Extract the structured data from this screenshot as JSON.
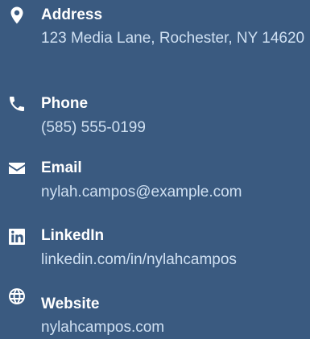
{
  "contact": {
    "items": [
      {
        "icon": "map-marker-icon",
        "label": "Address",
        "value": "123 Media Lane, Rochester, NY 14620"
      },
      {
        "icon": "phone-icon",
        "label": "Phone",
        "value": "(585) 555-0199"
      },
      {
        "icon": "envelope-icon",
        "label": "Email",
        "value": "nylah.campos@example.com"
      },
      {
        "icon": "linkedin-icon",
        "label": "LinkedIn",
        "value": "linkedin.com/in/nylahcampos"
      },
      {
        "icon": "globe-icon",
        "label": "Website",
        "value": "nylahcampos.com"
      }
    ]
  },
  "colors": {
    "background": "#3a5a80",
    "label": "#ffffff",
    "value": "#cfe0f2",
    "icon": "#ffffff"
  }
}
